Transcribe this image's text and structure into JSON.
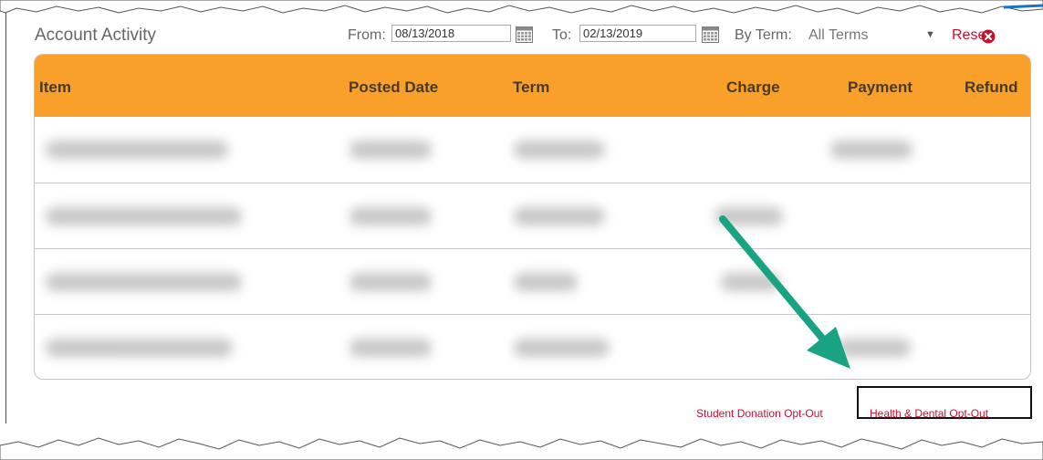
{
  "toolbar": {
    "title": "Account Activity",
    "from_label": "From:",
    "from_value": "08/13/2018",
    "to_label": "To:",
    "to_value": "02/13/2019",
    "term_label": "By Term:",
    "term_value": "All Terms",
    "reset_label": "Reset"
  },
  "table": {
    "columns": [
      "Item",
      "Posted Date",
      "Term",
      "Charge",
      "Payment",
      "Refund"
    ]
  },
  "links": {
    "student_donation": "Student Donation Opt-Out",
    "health_dental": "Health & Dental Opt-Out"
  },
  "colors": {
    "header": "#f8a02a",
    "link": "#c8102e",
    "arrow": "#1aa383"
  }
}
